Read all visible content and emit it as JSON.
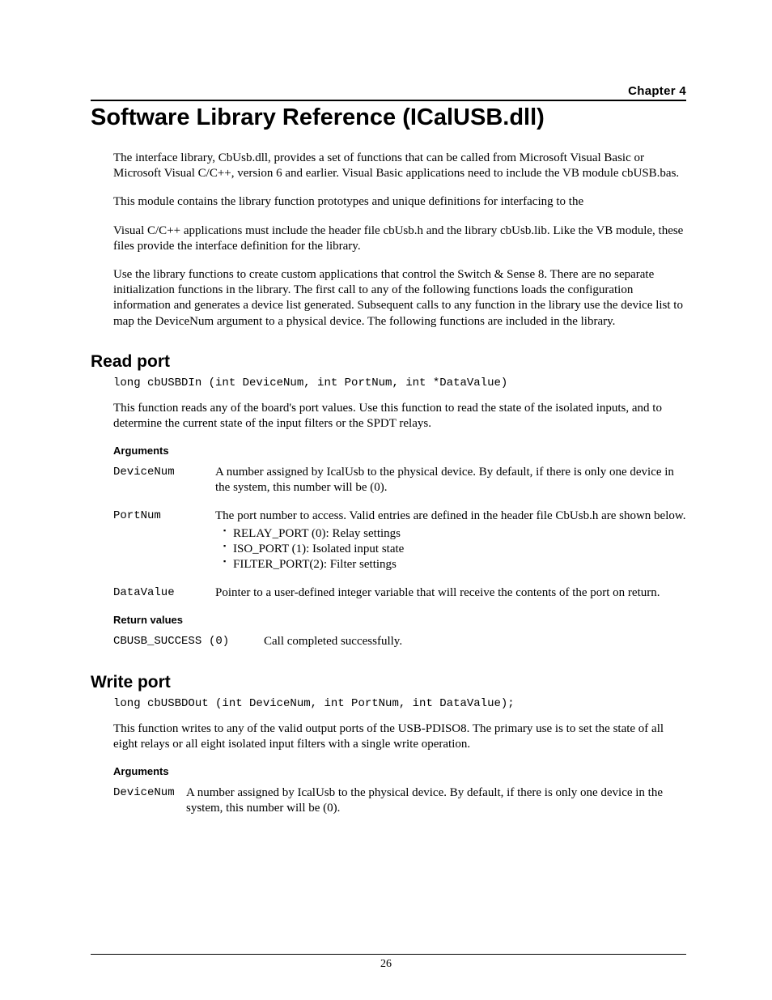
{
  "chapter_label": "Chapter 4",
  "title": "Software Library Reference (ICalUSB.dll)",
  "intro": [
    "The interface library, CbUsb.dll, provides a set of functions that can be called from Microsoft Visual Basic or Microsoft Visual C/C++, version 6 and earlier. Visual Basic applications need to include the VB module cbUSB.bas.",
    "This module contains the library function prototypes and unique definitions for interfacing to the",
    "Visual C/C++ applications must include the header file cbUsb.h and the library cbUsb.lib. Like the VB module, these files provide the interface definition for the library.",
    "Use the library functions to create custom applications that control the Switch & Sense 8. There are no separate initialization functions in the library. The first call to any of the following functions loads the configuration information and generates a device list generated. Subsequent calls to any function in the library use the device list to map the DeviceNum argument to a physical device. The following functions are included in the library."
  ],
  "read_port": {
    "heading": "Read port",
    "signature": "long cbUSBDIn (int DeviceNum, int PortNum, int *DataValue)",
    "desc": "This function reads any of the board's port values. Use this function to read the state of the isolated inputs, and to determine the current state of the input filters or the SPDT relays.",
    "args_heading": "Arguments",
    "args": [
      {
        "name": "DeviceNum",
        "desc": "A number assigned by IcalUsb to the physical device. By default, if there is only one device in the system, this number will be (0)."
      },
      {
        "name": "PortNum",
        "desc": "The port number to access. Valid entries are defined in the header file CbUsb.h  are shown below.",
        "sub": [
          "RELAY_PORT (0): Relay settings",
          "ISO_PORT (1): Isolated input state",
          "FILTER_PORT(2): Filter settings"
        ]
      },
      {
        "name": "DataValue",
        "desc": "Pointer to a user-defined integer variable that will receive the contents of the port on return."
      }
    ],
    "ret_heading": "Return values",
    "ret": {
      "name": "CBUSB_SUCCESS",
      "code": "(0)",
      "desc": "Call completed successfully."
    }
  },
  "write_port": {
    "heading": "Write port",
    "signature": "long cbUSBDOut (int DeviceNum, int PortNum, int DataValue);",
    "desc": "This function writes to any of the valid output ports of the USB-PDISO8. The primary use is to set the state of all eight relays or all eight isolated input filters with a single write operation.",
    "args_heading": "Arguments",
    "args": [
      {
        "name": "DeviceNum",
        "desc": "A number assigned by IcalUsb to the physical device. By default, if there is only one device in the system, this number will be (0)."
      }
    ]
  },
  "page_number": "26"
}
